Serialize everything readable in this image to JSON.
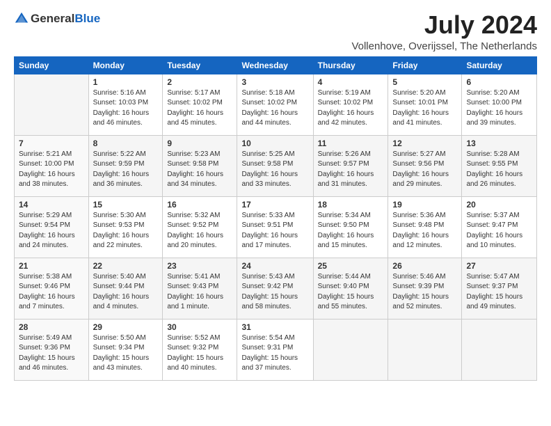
{
  "header": {
    "logo_general": "General",
    "logo_blue": "Blue",
    "month_year": "July 2024",
    "location": "Vollenhove, Overijssel, The Netherlands"
  },
  "calendar": {
    "weekdays": [
      "Sunday",
      "Monday",
      "Tuesday",
      "Wednesday",
      "Thursday",
      "Friday",
      "Saturday"
    ],
    "weeks": [
      [
        {
          "day": "",
          "info": ""
        },
        {
          "day": "1",
          "info": "Sunrise: 5:16 AM\nSunset: 10:03 PM\nDaylight: 16 hours\nand 46 minutes."
        },
        {
          "day": "2",
          "info": "Sunrise: 5:17 AM\nSunset: 10:02 PM\nDaylight: 16 hours\nand 45 minutes."
        },
        {
          "day": "3",
          "info": "Sunrise: 5:18 AM\nSunset: 10:02 PM\nDaylight: 16 hours\nand 44 minutes."
        },
        {
          "day": "4",
          "info": "Sunrise: 5:19 AM\nSunset: 10:02 PM\nDaylight: 16 hours\nand 42 minutes."
        },
        {
          "day": "5",
          "info": "Sunrise: 5:20 AM\nSunset: 10:01 PM\nDaylight: 16 hours\nand 41 minutes."
        },
        {
          "day": "6",
          "info": "Sunrise: 5:20 AM\nSunset: 10:00 PM\nDaylight: 16 hours\nand 39 minutes."
        }
      ],
      [
        {
          "day": "7",
          "info": "Sunrise: 5:21 AM\nSunset: 10:00 PM\nDaylight: 16 hours\nand 38 minutes."
        },
        {
          "day": "8",
          "info": "Sunrise: 5:22 AM\nSunset: 9:59 PM\nDaylight: 16 hours\nand 36 minutes."
        },
        {
          "day": "9",
          "info": "Sunrise: 5:23 AM\nSunset: 9:58 PM\nDaylight: 16 hours\nand 34 minutes."
        },
        {
          "day": "10",
          "info": "Sunrise: 5:25 AM\nSunset: 9:58 PM\nDaylight: 16 hours\nand 33 minutes."
        },
        {
          "day": "11",
          "info": "Sunrise: 5:26 AM\nSunset: 9:57 PM\nDaylight: 16 hours\nand 31 minutes."
        },
        {
          "day": "12",
          "info": "Sunrise: 5:27 AM\nSunset: 9:56 PM\nDaylight: 16 hours\nand 29 minutes."
        },
        {
          "day": "13",
          "info": "Sunrise: 5:28 AM\nSunset: 9:55 PM\nDaylight: 16 hours\nand 26 minutes."
        }
      ],
      [
        {
          "day": "14",
          "info": "Sunrise: 5:29 AM\nSunset: 9:54 PM\nDaylight: 16 hours\nand 24 minutes."
        },
        {
          "day": "15",
          "info": "Sunrise: 5:30 AM\nSunset: 9:53 PM\nDaylight: 16 hours\nand 22 minutes."
        },
        {
          "day": "16",
          "info": "Sunrise: 5:32 AM\nSunset: 9:52 PM\nDaylight: 16 hours\nand 20 minutes."
        },
        {
          "day": "17",
          "info": "Sunrise: 5:33 AM\nSunset: 9:51 PM\nDaylight: 16 hours\nand 17 minutes."
        },
        {
          "day": "18",
          "info": "Sunrise: 5:34 AM\nSunset: 9:50 PM\nDaylight: 16 hours\nand 15 minutes."
        },
        {
          "day": "19",
          "info": "Sunrise: 5:36 AM\nSunset: 9:48 PM\nDaylight: 16 hours\nand 12 minutes."
        },
        {
          "day": "20",
          "info": "Sunrise: 5:37 AM\nSunset: 9:47 PM\nDaylight: 16 hours\nand 10 minutes."
        }
      ],
      [
        {
          "day": "21",
          "info": "Sunrise: 5:38 AM\nSunset: 9:46 PM\nDaylight: 16 hours\nand 7 minutes."
        },
        {
          "day": "22",
          "info": "Sunrise: 5:40 AM\nSunset: 9:44 PM\nDaylight: 16 hours\nand 4 minutes."
        },
        {
          "day": "23",
          "info": "Sunrise: 5:41 AM\nSunset: 9:43 PM\nDaylight: 16 hours\nand 1 minute."
        },
        {
          "day": "24",
          "info": "Sunrise: 5:43 AM\nSunset: 9:42 PM\nDaylight: 15 hours\nand 58 minutes."
        },
        {
          "day": "25",
          "info": "Sunrise: 5:44 AM\nSunset: 9:40 PM\nDaylight: 15 hours\nand 55 minutes."
        },
        {
          "day": "26",
          "info": "Sunrise: 5:46 AM\nSunset: 9:39 PM\nDaylight: 15 hours\nand 52 minutes."
        },
        {
          "day": "27",
          "info": "Sunrise: 5:47 AM\nSunset: 9:37 PM\nDaylight: 15 hours\nand 49 minutes."
        }
      ],
      [
        {
          "day": "28",
          "info": "Sunrise: 5:49 AM\nSunset: 9:36 PM\nDaylight: 15 hours\nand 46 minutes."
        },
        {
          "day": "29",
          "info": "Sunrise: 5:50 AM\nSunset: 9:34 PM\nDaylight: 15 hours\nand 43 minutes."
        },
        {
          "day": "30",
          "info": "Sunrise: 5:52 AM\nSunset: 9:32 PM\nDaylight: 15 hours\nand 40 minutes."
        },
        {
          "day": "31",
          "info": "Sunrise: 5:54 AM\nSunset: 9:31 PM\nDaylight: 15 hours\nand 37 minutes."
        },
        {
          "day": "",
          "info": ""
        },
        {
          "day": "",
          "info": ""
        },
        {
          "day": "",
          "info": ""
        }
      ]
    ]
  }
}
